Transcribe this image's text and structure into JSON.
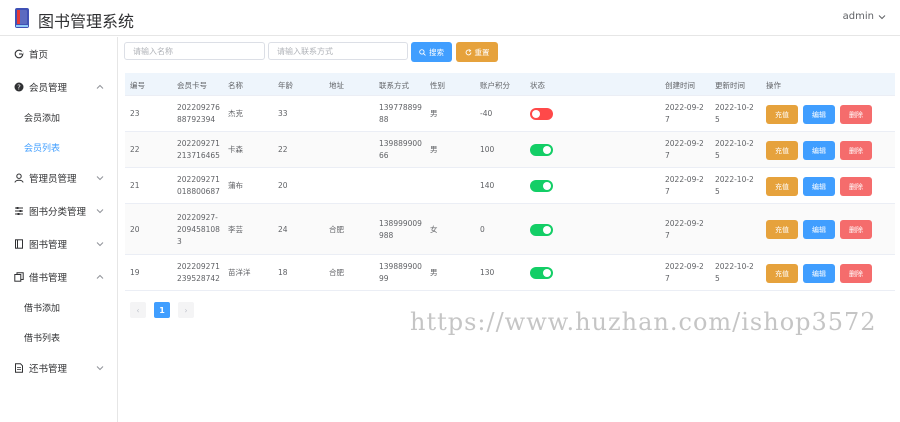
{
  "app": {
    "title": "图书管理系统",
    "user": "admin"
  },
  "sidebar": {
    "items": [
      {
        "label": "首页",
        "icon": "home-icon"
      },
      {
        "label": "会员管理",
        "icon": "question-circle-icon",
        "expanded": true,
        "children": [
          {
            "label": "会员添加"
          },
          {
            "label": "会员列表",
            "active": true
          }
        ]
      },
      {
        "label": "管理员管理",
        "icon": "user-icon"
      },
      {
        "label": "图书分类管理",
        "icon": "sliders-icon"
      },
      {
        "label": "图书管理",
        "icon": "book-icon"
      },
      {
        "label": "借书管理",
        "icon": "copy-icon",
        "expanded": true,
        "children": [
          {
            "label": "借书添加"
          },
          {
            "label": "借书列表"
          }
        ]
      },
      {
        "label": "还书管理",
        "icon": "document-icon"
      }
    ]
  },
  "search": {
    "name_placeholder": "请输入名称",
    "contact_placeholder": "请输入联系方式",
    "search_label": "搜索",
    "reset_label": "重置"
  },
  "table": {
    "headers": [
      "编号",
      "会员卡号",
      "名称",
      "年龄",
      "地址",
      "联系方式",
      "性别",
      "账户积分",
      "状态",
      "创建时间",
      "更新时间",
      "操作"
    ],
    "rows": [
      {
        "id": "23",
        "card": "20220927688792394",
        "card_lines": "202209276\n88792394",
        "name": "杰克",
        "age": "33",
        "address": "",
        "phone": "13977889988",
        "phone_lines": "139778899\n88",
        "gender": "男",
        "points": "-40",
        "status": false,
        "created": "2022-09-2\n7",
        "updated": "2022-10-2\n5"
      },
      {
        "id": "22",
        "card": "20220927121371646 5",
        "card_lines": "202209271\n213716465",
        "name": "卡森",
        "age": "22",
        "address": "",
        "phone": "13988990066",
        "phone_lines": "139889900\n66",
        "gender": "男",
        "points": "100",
        "status": true,
        "created": "2022-09-2\n7",
        "updated": "2022-10-2\n5"
      },
      {
        "id": "21",
        "card": "202209271018800687",
        "card_lines": "202209271\n018800687",
        "name": "蒲布",
        "age": "20",
        "address": "",
        "phone": "",
        "phone_lines": "",
        "gender": "",
        "points": "140",
        "status": true,
        "created": "2022-09-2\n7",
        "updated": "2022-10-2\n5"
      },
      {
        "id": "20",
        "card": "20220927-2094581083",
        "card_lines": "20220927-\n209458108\n3",
        "name": "李芸",
        "age": "24",
        "address": "合肥",
        "phone": "138999009988",
        "phone_lines": "138999009\n988",
        "gender": "女",
        "points": "0",
        "status": true,
        "created": "2022-09-2\n7",
        "updated": ""
      },
      {
        "id": "19",
        "card": "202209271239528742",
        "card_lines": "202209271\n239528742",
        "name": "苗洋洋",
        "age": "18",
        "address": "合肥",
        "phone": "13988990099",
        "phone_lines": "139889900\n99",
        "gender": "男",
        "points": "130",
        "status": true,
        "created": "2022-09-2\n7",
        "updated": "2022-10-2\n5"
      }
    ],
    "actions": {
      "charge": "充值",
      "edit": "编辑",
      "delete": "删除"
    }
  },
  "pagination": {
    "current_page": "1",
    "prev": "‹",
    "next": "›"
  },
  "watermark": "https://www.huzhan.com/ishop3572",
  "colors": {
    "primary": "#409eff",
    "warning": "#e6a23c",
    "danger": "#f56c6c",
    "success": "#13ce66",
    "switch_off": "#ff4949"
  }
}
